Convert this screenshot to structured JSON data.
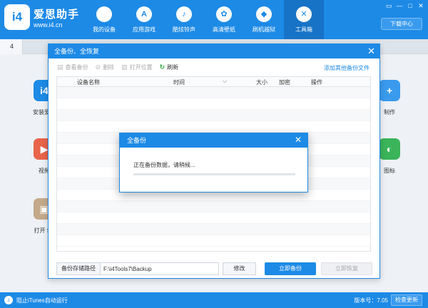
{
  "app": {
    "logo_text": "i4",
    "name": "爱思助手",
    "url": "www.i4.cn"
  },
  "nav": [
    {
      "label": "我的设备",
      "icon": "apple-icon",
      "glyph": ""
    },
    {
      "label": "应用游戏",
      "icon": "app-store-icon",
      "glyph": "A"
    },
    {
      "label": "酷炫铃声",
      "icon": "bell-icon",
      "glyph": "♪"
    },
    {
      "label": "高清壁纸",
      "icon": "flower-icon",
      "glyph": "✿"
    },
    {
      "label": "刷机越狱",
      "icon": "box-icon",
      "glyph": "◆"
    },
    {
      "label": "工具箱",
      "icon": "tools-icon",
      "glyph": "✕"
    }
  ],
  "window_controls": [
    "▭",
    "—",
    "□",
    "✕"
  ],
  "download_center_label": "下载中心",
  "tab_label": "4",
  "side_apps": [
    {
      "label": "安装爱思",
      "glyph": "i4",
      "color": "#1d8ae6"
    },
    {
      "label": "视频",
      "glyph": "▶",
      "color": "#e8644a"
    },
    {
      "label": "打开 SS",
      "glyph": "▣",
      "color": "#c4a98a"
    },
    {
      "label": "制作",
      "glyph": "+",
      "color": "#3a9bee"
    },
    {
      "label": "图标",
      "glyph": "◐",
      "color": "#3bb45a"
    }
  ],
  "dialog": {
    "title": "全备份、全恢复",
    "close_glyph": "✕",
    "toolbar": [
      {
        "label": "查看备份",
        "icon": "view-icon",
        "glyph": "▤",
        "enabled": false
      },
      {
        "label": "删除",
        "icon": "delete-icon",
        "glyph": "⊘",
        "enabled": false
      },
      {
        "label": "打开位置",
        "icon": "folder-icon",
        "glyph": "▥",
        "enabled": false
      },
      {
        "label": "刷新",
        "icon": "refresh-icon",
        "glyph": "↻",
        "enabled": true
      }
    ],
    "add_link": "添加其他备份文件",
    "columns": [
      "设备名称",
      "时间",
      "大小",
      "加密",
      "操作"
    ],
    "sort_arrow": "⌵",
    "path_label": "备份存储路径",
    "path_value": "F:\\i4Tools7\\Backup",
    "modify_button": "修改",
    "backup_button": "立即备份",
    "restore_button": "立即恢复"
  },
  "popup": {
    "title": "全备份",
    "close_glyph": "✕",
    "message": "正在备份数据，请稍候...",
    "progress": 0.0
  },
  "statusbar": {
    "itunes_text": "阻止iTunes自动运行",
    "version": "版本号：7.05",
    "update_button": "检查更新"
  }
}
